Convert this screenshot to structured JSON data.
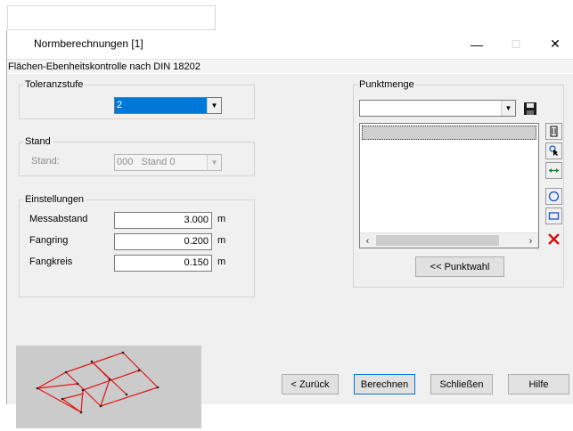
{
  "window": {
    "title": "Normberechnungen [1]",
    "subtitle": "Flächen-Ebenheitskontrolle nach DIN 18202",
    "minimize_glyph": "—",
    "maximize_glyph": "☐",
    "close_glyph": "✕"
  },
  "toleranzstufe": {
    "legend": "Toleranzstufe",
    "value": "2"
  },
  "stand": {
    "legend": "Stand",
    "label": "Stand:",
    "code": "000",
    "name": "Stand 0"
  },
  "einstellungen": {
    "legend": "Einstellungen",
    "rows": [
      {
        "label": "Messabstand",
        "value": "3.000",
        "unit": "m"
      },
      {
        "label": "Fangring",
        "value": "0.200",
        "unit": "m"
      },
      {
        "label": "Fangkreis",
        "value": "0.150",
        "unit": "m"
      }
    ]
  },
  "punktmenge": {
    "legend": "Punktmenge",
    "combo_value": "",
    "punktwahl_label": "<< Punktwahl",
    "scroll_left": "‹",
    "scroll_right": "›",
    "tool_icons": [
      "document-icon",
      "pointer-pick-icon",
      "horizontal-arrows-icon",
      "circle-select-icon",
      "rectangle-select-icon",
      "delete-x-icon"
    ]
  },
  "buttons": {
    "back": "< Zurück",
    "calculate": "Berechnen",
    "close": "Schließen",
    "help": "Hilfe"
  },
  "colors": {
    "grid_lines": "#e01818",
    "selection": "#0078d7",
    "dialog_bg": "#f0f0f0",
    "preview_bg": "#cbcbcb"
  }
}
